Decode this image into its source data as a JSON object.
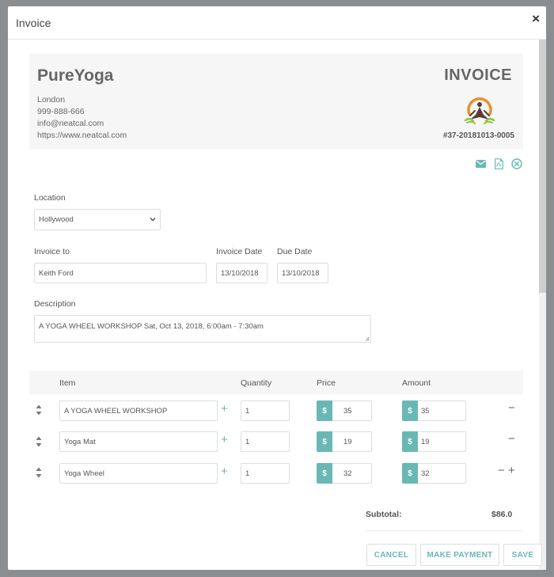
{
  "modal": {
    "title": "Invoice",
    "close": "×"
  },
  "company": {
    "name": "PureYoga",
    "city": "London",
    "phone": "999-888-666",
    "email": "info@neatcal.com",
    "website": "https://www.neatcal.com"
  },
  "invoice": {
    "label": "INVOICE",
    "number": "#37-20181013-0005"
  },
  "form": {
    "location_label": "Location",
    "location_value": "Hollywood",
    "invoice_to_label": "Invoice to",
    "invoice_to_value": "Keith Ford",
    "invoice_date_label": "Invoice Date",
    "invoice_date_value": "13/10/2018",
    "due_date_label": "Due Date",
    "due_date_value": "13/10/2018",
    "description_label": "Description",
    "description_value": "A YOGA WHEEL WORKSHOP Sat, Oct 13, 2018, 6:00am - 7:30am"
  },
  "table": {
    "headers": {
      "item": "Item",
      "quantity": "Quantity",
      "price": "Price",
      "amount": "Amount"
    },
    "currency": "$",
    "rows": [
      {
        "item": "A YOGA WHEEL WORKSHOP",
        "quantity": "1",
        "price": "35",
        "amount": "35"
      },
      {
        "item": "Yoga Mat",
        "quantity": "1",
        "price": "19",
        "amount": "19"
      },
      {
        "item": "Yoga Wheel",
        "quantity": "1",
        "price": "32",
        "amount": "32"
      }
    ],
    "plus": "+",
    "minus": "−"
  },
  "summary": {
    "subtotal_label": "Subtotal:",
    "subtotal_value": "$86.0"
  },
  "buttons": {
    "cancel": "CANCEL",
    "make_payment": "MAKE PAYMENT",
    "save": "SAVE"
  },
  "colors": {
    "accent": "#6ab8b3",
    "header_bg": "#f6f6f6"
  }
}
